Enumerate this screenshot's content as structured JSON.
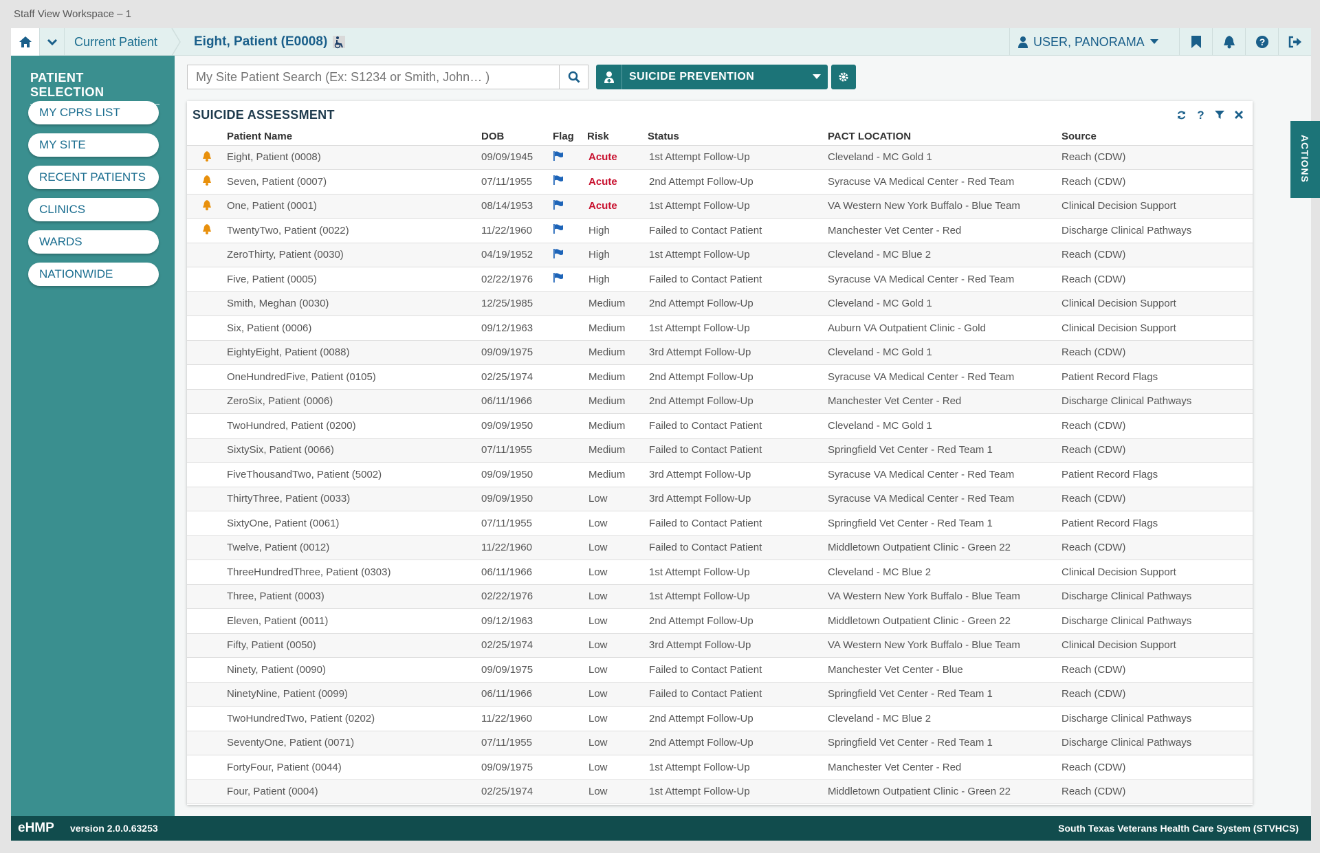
{
  "window": {
    "title": "Staff View Workspace – 1"
  },
  "topbar": {
    "breadcrumb": "Current Patient",
    "patient_title": "Eight, Patient (E0008)",
    "user": "USER, PANORAMA"
  },
  "sidebar": {
    "heading": "PATIENT SELECTION",
    "items": [
      "MY CPRS LIST",
      "MY SITE",
      "RECENT PATIENTS",
      "CLINICS",
      "WARDS",
      "NATIONWIDE"
    ]
  },
  "search": {
    "placeholder": "My Site Patient Search (Ex: S1234 or Smith, John… )"
  },
  "workspace_select": {
    "label": "SUICIDE PREVENTION"
  },
  "applet": {
    "title": "SUICIDE ASSESSMENT",
    "columns": [
      "Patient Name",
      "DOB",
      "Flag",
      "Risk",
      "Status",
      "PACT LOCATION",
      "Source"
    ],
    "rows": [
      {
        "bell": true,
        "name": "Eight, Patient (0008)",
        "dob": "09/09/1945",
        "flag": true,
        "risk": "Acute",
        "status": "1st Attempt Follow-Up",
        "pact": "Cleveland - MC Gold 1",
        "source": "Reach (CDW)"
      },
      {
        "bell": true,
        "name": "Seven, Patient (0007)",
        "dob": "07/11/1955",
        "flag": true,
        "risk": "Acute",
        "status": "2nd Attempt Follow-Up",
        "pact": "Syracuse VA Medical Center - Red Team",
        "source": "Reach (CDW)"
      },
      {
        "bell": true,
        "name": "One, Patient (0001)",
        "dob": "08/14/1953",
        "flag": true,
        "risk": "Acute",
        "status": "1st Attempt Follow-Up",
        "pact": "VA Western New York Buffalo - Blue Team",
        "source": "Clinical Decision Support"
      },
      {
        "bell": true,
        "name": "TwentyTwo, Patient (0022)",
        "dob": "11/22/1960",
        "flag": true,
        "risk": "High",
        "status": "Failed to Contact Patient",
        "pact": "Manchester Vet Center - Red",
        "source": "Discharge Clinical Pathways"
      },
      {
        "bell": false,
        "name": "ZeroThirty, Patient (0030)",
        "dob": "04/19/1952",
        "flag": true,
        "risk": "High",
        "status": "1st Attempt Follow-Up",
        "pact": "Cleveland - MC Blue 2",
        "source": "Reach (CDW)"
      },
      {
        "bell": false,
        "name": "Five, Patient (0005)",
        "dob": "02/22/1976",
        "flag": true,
        "risk": "High",
        "status": "Failed to Contact Patient",
        "pact": "Syracuse VA Medical Center - Red Team",
        "source": "Reach (CDW)"
      },
      {
        "bell": false,
        "name": "Smith, Meghan (0030)",
        "dob": "12/25/1985",
        "flag": false,
        "risk": "Medium",
        "status": "2nd Attempt Follow-Up",
        "pact": "Cleveland - MC Gold 1",
        "source": "Clinical Decision Support"
      },
      {
        "bell": false,
        "name": "Six, Patient (0006)",
        "dob": "09/12/1963",
        "flag": false,
        "risk": "Medium",
        "status": "1st Attempt Follow-Up",
        "pact": "Auburn VA Outpatient Clinic - Gold",
        "source": "Clinical Decision Support"
      },
      {
        "bell": false,
        "name": "EightyEight, Patient (0088)",
        "dob": "09/09/1975",
        "flag": false,
        "risk": "Medium",
        "status": "3rd Attempt Follow-Up",
        "pact": "Cleveland - MC Gold 1",
        "source": "Reach (CDW)"
      },
      {
        "bell": false,
        "name": "OneHundredFive, Patient (0105)",
        "dob": "02/25/1974",
        "flag": false,
        "risk": "Medium",
        "status": "2nd Attempt Follow-Up",
        "pact": "Syracuse VA Medical Center - Red Team",
        "source": "Patient Record Flags"
      },
      {
        "bell": false,
        "name": "ZeroSix, Patient (0006)",
        "dob": "06/11/1966",
        "flag": false,
        "risk": "Medium",
        "status": "2nd Attempt Follow-Up",
        "pact": "Manchester Vet Center - Red",
        "source": "Discharge Clinical Pathways"
      },
      {
        "bell": false,
        "name": "TwoHundred, Patient (0200)",
        "dob": "09/09/1950",
        "flag": false,
        "risk": "Medium",
        "status": "Failed to Contact Patient",
        "pact": "Cleveland - MC Gold 1",
        "source": "Reach (CDW)"
      },
      {
        "bell": false,
        "name": "SixtySix, Patient (0066)",
        "dob": "07/11/1955",
        "flag": false,
        "risk": "Medium",
        "status": "Failed to Contact Patient",
        "pact": "Springfield Vet Center - Red Team 1",
        "source": "Reach (CDW)"
      },
      {
        "bell": false,
        "name": "FiveThousandTwo, Patient (5002)",
        "dob": "09/09/1950",
        "flag": false,
        "risk": "Medium",
        "status": "3rd Attempt Follow-Up",
        "pact": "Syracuse VA Medical Center - Red Team",
        "source": "Patient Record Flags"
      },
      {
        "bell": false,
        "name": "ThirtyThree, Patient (0033)",
        "dob": "09/09/1950",
        "flag": false,
        "risk": "Low",
        "status": "3rd Attempt Follow-Up",
        "pact": "Syracuse VA Medical Center - Red Team",
        "source": "Reach (CDW)"
      },
      {
        "bell": false,
        "name": "SixtyOne, Patient (0061)",
        "dob": "07/11/1955",
        "flag": false,
        "risk": "Low",
        "status": "Failed to Contact Patient",
        "pact": "Springfield Vet Center - Red Team 1",
        "source": "Patient Record Flags"
      },
      {
        "bell": false,
        "name": "Twelve, Patient (0012)",
        "dob": "11/22/1960",
        "flag": false,
        "risk": "Low",
        "status": "Failed to Contact Patient",
        "pact": "Middletown Outpatient Clinic - Green 22",
        "source": "Reach (CDW)"
      },
      {
        "bell": false,
        "name": "ThreeHundredThree, Patient (0303)",
        "dob": "06/11/1966",
        "flag": false,
        "risk": "Low",
        "status": "1st Attempt Follow-Up",
        "pact": "Cleveland - MC Blue 2",
        "source": "Clinical Decision Support"
      },
      {
        "bell": false,
        "name": "Three, Patient (0003)",
        "dob": "02/22/1976",
        "flag": false,
        "risk": "Low",
        "status": "1st Attempt Follow-Up",
        "pact": "VA Western New York Buffalo - Blue Team",
        "source": "Discharge Clinical Pathways"
      },
      {
        "bell": false,
        "name": "Eleven, Patient (0011)",
        "dob": "09/12/1963",
        "flag": false,
        "risk": "Low",
        "status": "2nd Attempt Follow-Up",
        "pact": "Middletown Outpatient Clinic - Green 22",
        "source": "Discharge Clinical Pathways"
      },
      {
        "bell": false,
        "name": "Fifty, Patient (0050)",
        "dob": "02/25/1974",
        "flag": false,
        "risk": "Low",
        "status": "3rd Attempt Follow-Up",
        "pact": "VA Western New York Buffalo - Blue Team",
        "source": "Clinical Decision Support"
      },
      {
        "bell": false,
        "name": "Ninety, Patient (0090)",
        "dob": "09/09/1975",
        "flag": false,
        "risk": "Low",
        "status": "Failed to Contact Patient",
        "pact": "Manchester Vet Center - Blue",
        "source": "Reach (CDW)"
      },
      {
        "bell": false,
        "name": "NinetyNine, Patient (0099)",
        "dob": "06/11/1966",
        "flag": false,
        "risk": "Low",
        "status": "Failed to Contact Patient",
        "pact": "Springfield Vet Center - Red Team 1",
        "source": "Reach (CDW)"
      },
      {
        "bell": false,
        "name": "TwoHundredTwo, Patient (0202)",
        "dob": "11/22/1960",
        "flag": false,
        "risk": "Low",
        "status": "2nd Attempt Follow-Up",
        "pact": "Cleveland - MC Blue 2",
        "source": "Discharge Clinical Pathways"
      },
      {
        "bell": false,
        "name": "SeventyOne, Patient (0071)",
        "dob": "07/11/1955",
        "flag": false,
        "risk": "Low",
        "status": "2nd Attempt Follow-Up",
        "pact": "Springfield Vet Center - Red Team 1",
        "source": "Discharge Clinical Pathways"
      },
      {
        "bell": false,
        "name": "FortyFour, Patient (0044)",
        "dob": "09/09/1975",
        "flag": false,
        "risk": "Low",
        "status": "1st Attempt Follow-Up",
        "pact": "Manchester Vet Center - Red",
        "source": "Reach (CDW)"
      },
      {
        "bell": false,
        "name": "Four, Patient (0004)",
        "dob": "02/25/1974",
        "flag": false,
        "risk": "Low",
        "status": "1st Attempt Follow-Up",
        "pact": "Middletown Outpatient Clinic - Green 22",
        "source": "Reach (CDW)"
      }
    ]
  },
  "actions_tab": "ACTIONS",
  "footer": {
    "brand": "eHMP",
    "version": "version 2.0.0.63253",
    "org": "South Texas Veterans Health Care System (STVHCS)"
  },
  "colors": {
    "teal_sidebar": "#3a8f8f",
    "teal_dark": "#1c7478",
    "footer": "#114c4d",
    "link_blue": "#1a6d8f",
    "acute_red": "#c8102e",
    "bell_orange": "#e8900c",
    "flag_blue": "#1d64b8"
  },
  "icons": [
    "home-icon",
    "chevron-down-icon",
    "wheelchair-icon",
    "user-icon",
    "caret-down-icon",
    "bookmark-icon",
    "bell-icon",
    "help-icon",
    "sign-out-icon",
    "search-icon",
    "user-md-icon",
    "gear-icon",
    "refresh-icon",
    "question-icon",
    "filter-icon",
    "close-icon",
    "flag-icon"
  ]
}
